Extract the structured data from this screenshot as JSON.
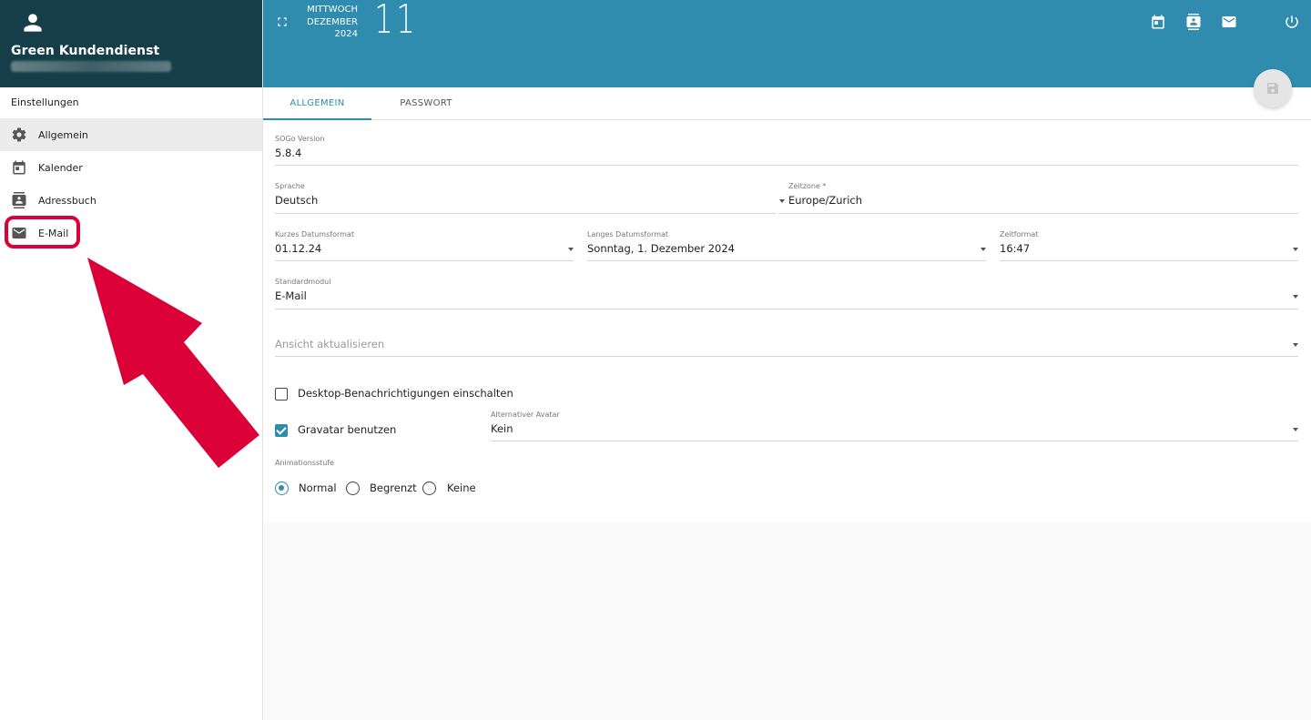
{
  "sidebar": {
    "user_name": "Green Kundendienst",
    "section_title": "Einstellungen",
    "items": [
      {
        "label": "Allgemein",
        "icon": "gear-icon"
      },
      {
        "label": "Kalender",
        "icon": "calendar-icon"
      },
      {
        "label": "Adressbuch",
        "icon": "contacts-icon"
      },
      {
        "label": "E-Mail",
        "icon": "mail-icon"
      }
    ]
  },
  "topbar": {
    "weekday": "MITTWOCH",
    "month": "DEZEMBER",
    "year": "2024",
    "day": "11"
  },
  "tabs": [
    {
      "label": "ALLGEMEIN",
      "active": true
    },
    {
      "label": "PASSWORT",
      "active": false
    }
  ],
  "form": {
    "sogo_version": {
      "label": "SOGo Version",
      "value": "5.8.4"
    },
    "language": {
      "label": "Sprache",
      "value": "Deutsch"
    },
    "timezone": {
      "label": "Zeitzone *",
      "value": "Europe/Zurich"
    },
    "short_date": {
      "label": "Kurzes Datumsformat",
      "value": "01.12.24"
    },
    "long_date": {
      "label": "Langes Datumsformat",
      "value": "Sonntag, 1. Dezember 2024"
    },
    "time_format": {
      "label": "Zeitformat",
      "value": "16:47"
    },
    "default_module": {
      "label": "Standardmodul",
      "value": "E-Mail"
    },
    "refresh_view": {
      "placeholder": "Ansicht aktualisieren"
    },
    "desktop_notifications": {
      "label": "Desktop-Benachrichtigungen einschalten",
      "checked": false
    },
    "gravatar": {
      "label": "Gravatar benutzen",
      "checked": true
    },
    "alt_avatar": {
      "label": "Alternativer Avatar",
      "value": "Kein"
    },
    "animation": {
      "label": "Animationsstufe",
      "options": [
        "Normal",
        "Begrenzt",
        "Keine"
      ],
      "selected": "Normal"
    }
  },
  "colors": {
    "topbar": "#2f8cae",
    "sidebar_header": "#163e48",
    "accent": "#2f8cae",
    "annotation": "#dc0039"
  }
}
